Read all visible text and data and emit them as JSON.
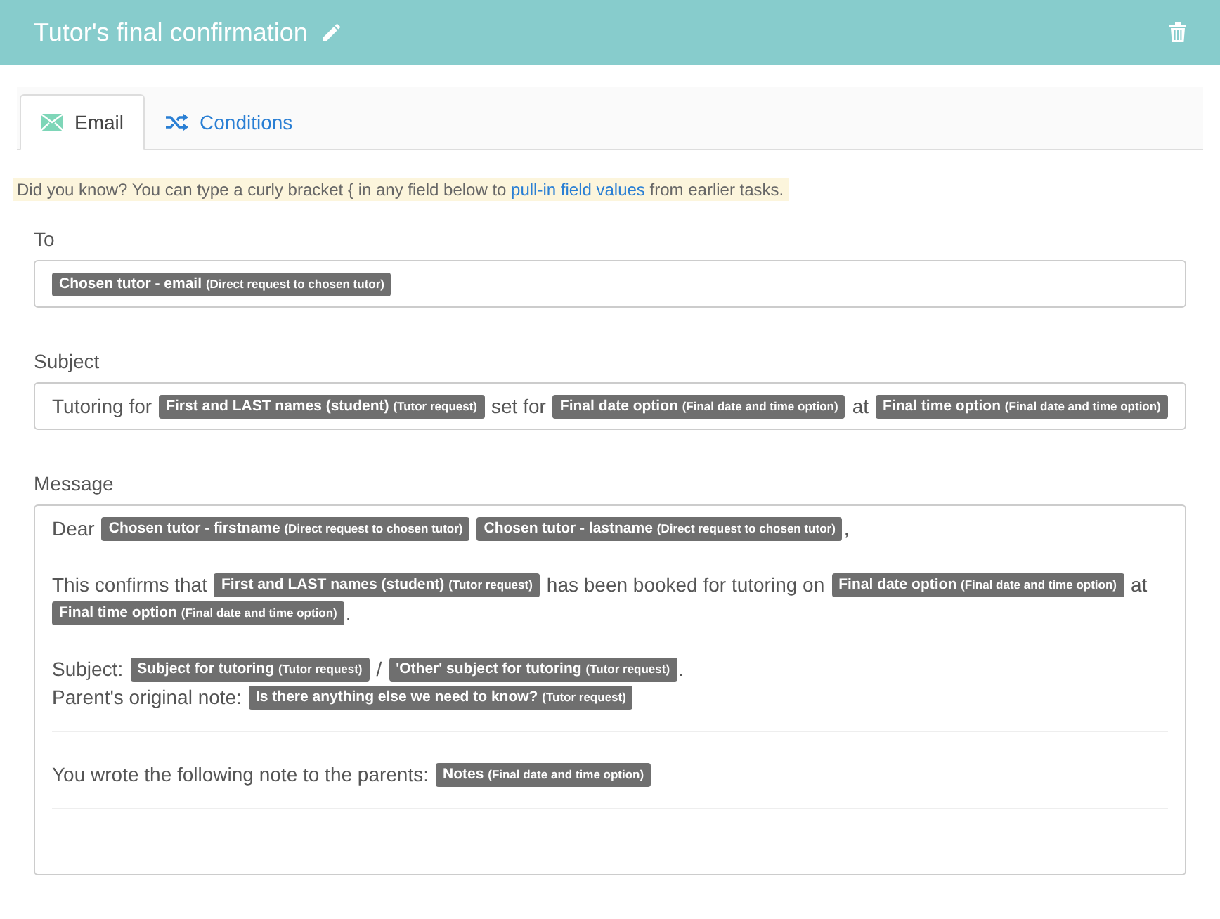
{
  "header": {
    "title": "Tutor's final confirmation"
  },
  "tabs": [
    {
      "label": "Email",
      "kind": "email",
      "selected": true
    },
    {
      "label": "Conditions",
      "kind": "conditions",
      "selected": false
    }
  ],
  "hint": {
    "before": "Did you know? You can type a curly bracket { in any field below to",
    "link": "pull-in field values",
    "after": "from earlier tasks."
  },
  "fields": [
    {
      "label": "To",
      "kind": "line",
      "lines": [
        [
          {
            "kind": "token",
            "label": "Chosen tutor - email",
            "source": "(Direct request to chosen tutor)"
          }
        ]
      ]
    },
    {
      "label": "Subject",
      "kind": "line",
      "lines": [
        [
          {
            "kind": "text",
            "text": "Tutoring for"
          },
          {
            "kind": "token",
            "label": "First and LAST names (student)",
            "source": "(Tutor request)"
          },
          {
            "kind": "text",
            "text": "set for"
          },
          {
            "kind": "token",
            "label": "Final date option",
            "source": "(Final date and time option)"
          },
          {
            "kind": "text",
            "text": "at"
          },
          {
            "kind": "token",
            "label": "Final time option",
            "source": "(Final date and time option)"
          }
        ]
      ]
    },
    {
      "label": "Message",
      "kind": "area",
      "blocks": [
        {
          "kind": "para",
          "lines": [
            [
              {
                "kind": "text",
                "text": "Dear"
              },
              {
                "kind": "token",
                "label": "Chosen tutor - firstname",
                "source": "(Direct request to chosen tutor)"
              },
              {
                "kind": "token",
                "label": "Chosen tutor - lastname",
                "source": "(Direct request to chosen tutor)"
              },
              {
                "kind": "punct",
                "text": ","
              }
            ]
          ]
        },
        {
          "kind": "para",
          "lines": [
            [
              {
                "kind": "text",
                "text": "This confirms that"
              },
              {
                "kind": "token",
                "label": "First and LAST names (student)",
                "source": "(Tutor request)"
              },
              {
                "kind": "text",
                "text": "has been booked for tutoring on"
              },
              {
                "kind": "token",
                "label": "Final date option",
                "source": "(Final date and time option)"
              },
              {
                "kind": "text",
                "text": "at"
              }
            ],
            [
              {
                "kind": "token",
                "label": "Final time option",
                "source": "(Final date and time option)"
              },
              {
                "kind": "punct",
                "text": "."
              }
            ]
          ]
        },
        {
          "kind": "para",
          "lines": [
            [
              {
                "kind": "text",
                "text": "Subject:"
              },
              {
                "kind": "token",
                "label": "Subject for tutoring",
                "source": "(Tutor request)"
              },
              {
                "kind": "text",
                "text": "/"
              },
              {
                "kind": "token",
                "label": "'Other' subject for tutoring",
                "source": "(Tutor request)"
              },
              {
                "kind": "punct",
                "text": "."
              }
            ],
            [
              {
                "kind": "text",
                "text": "Parent's original note:"
              },
              {
                "kind": "token",
                "label": "Is there anything else we need to know?",
                "source": "(Tutor request)"
              }
            ]
          ]
        },
        {
          "kind": "rule"
        },
        {
          "kind": "para",
          "lines": [
            [
              {
                "kind": "text",
                "text": "You wrote the following note to the parents:"
              },
              {
                "kind": "token",
                "label": "Notes",
                "source": "(Final date and time option)"
              }
            ]
          ]
        },
        {
          "kind": "rule"
        }
      ]
    }
  ]
}
